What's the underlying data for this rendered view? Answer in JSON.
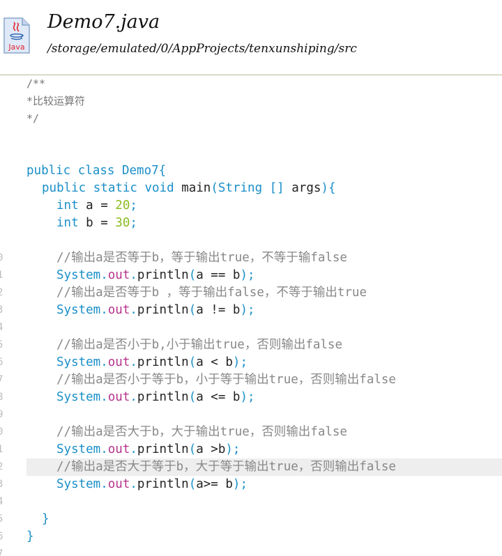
{
  "header": {
    "file_name": "Demo7.java",
    "file_path": "/storage/emulated/0/AppProjects/tenxunshiping/src",
    "file_icon_label": "Java"
  },
  "gutter": [
    "0",
    "1",
    "2",
    "3",
    "4",
    "5",
    "6",
    "7",
    "8",
    "9",
    "0",
    "1",
    "2",
    "3",
    "4",
    "5",
    "6",
    "7"
  ],
  "code": {
    "doc_open": "/**",
    "doc_desc": "*比较运算符",
    "doc_close": "*/",
    "l_class_kw": "public class ",
    "l_class_name": "Demo7{",
    "l_main_kw1": "public static void ",
    "l_main_name": "main",
    "l_main_paren": "(",
    "l_main_type": "String [] ",
    "l_main_args": "args",
    "l_main_end": "){",
    "l_int_kw": "int",
    "l_a_decl": " a = ",
    "l_a_val": "20",
    "l_b_decl": " b = ",
    "l_b_val": "30",
    "semi": ";",
    "c1": "//输出a是否等于b，等于输出true，不等于输false",
    "c2": "//输出a是否等于b ，等于输出false，不等于输出true",
    "c3": "//输出a是否小于b,小于输出true，否则输出false",
    "c4": "//输出a是否小于等于b，小于等于输出true，否则输出false",
    "c5": "//输出a是否大于b，大于输出true，否则输出false",
    "c6": "//输出a是否大于等于b，大于等于输出true，否则输出false",
    "sys": "System",
    "dot": ".",
    "out": "out",
    "println": "println",
    "open_paren": "(",
    "close_paren": ");",
    "e1": "a == b",
    "e2": "a != b",
    "e3": "a < b",
    "e4": "a <= b",
    "e5": "a >b",
    "e6": "a>= b",
    "close_brace": "}"
  }
}
